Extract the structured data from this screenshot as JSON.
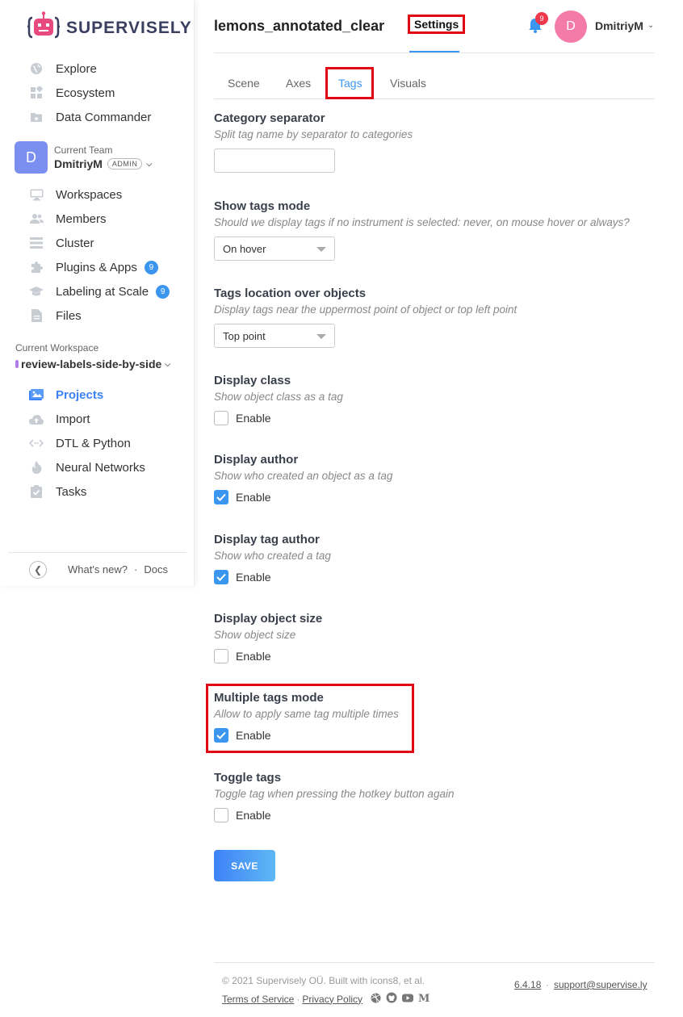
{
  "brand": {
    "name": "SUPERVISELY"
  },
  "sidebar": {
    "top_items": [
      {
        "label": "Explore",
        "icon": "globe-icon"
      },
      {
        "label": "Ecosystem",
        "icon": "grid-icon"
      },
      {
        "label": "Data Commander",
        "icon": "folder-star-icon"
      }
    ],
    "team": {
      "label": "Current Team",
      "name": "DmitriyM",
      "role": "ADMIN",
      "avatar_letter": "D"
    },
    "team_items": [
      {
        "label": "Workspaces",
        "icon": "monitor-icon"
      },
      {
        "label": "Members",
        "icon": "users-icon"
      },
      {
        "label": "Cluster",
        "icon": "list-icon"
      },
      {
        "label": "Plugins & Apps",
        "icon": "puzzle-icon",
        "badge": "9"
      },
      {
        "label": "Labeling at Scale",
        "icon": "graduation-cap-icon",
        "badge": "9"
      },
      {
        "label": "Files",
        "icon": "file-icon"
      }
    ],
    "workspace": {
      "label": "Current Workspace",
      "name": "review-labels-side-by-side"
    },
    "workspace_items": [
      {
        "label": "Projects",
        "icon": "images-icon",
        "active": true
      },
      {
        "label": "Import",
        "icon": "cloud-upload-icon"
      },
      {
        "label": "DTL & Python",
        "icon": "code-icon"
      },
      {
        "label": "Neural Networks",
        "icon": "fire-icon"
      },
      {
        "label": "Tasks",
        "icon": "clipboard-check-icon"
      }
    ],
    "footer": {
      "whats_new": "What's new?",
      "separator": "·",
      "docs": "Docs"
    }
  },
  "header": {
    "title": "lemons_annotated_clear",
    "tab": "Settings",
    "notifications": "9",
    "user": {
      "avatar_letter": "D",
      "name": "DmitriyM"
    }
  },
  "subtabs": [
    "Scene",
    "Axes",
    "Tags",
    "Visuals"
  ],
  "settings": {
    "category_separator": {
      "title": "Category separator",
      "desc": "Split tag name by separator to categories",
      "value": ""
    },
    "show_tags_mode": {
      "title": "Show tags mode",
      "desc": "Should we display tags if no instrument is selected: never, on mouse hover or always?",
      "value": "On hover"
    },
    "tags_location": {
      "title": "Tags location over objects",
      "desc": "Display tags near the uppermost point of object or top left point",
      "value": "Top point"
    },
    "display_class": {
      "title": "Display class",
      "desc": "Show object class as a tag",
      "label": "Enable",
      "checked": false
    },
    "display_author": {
      "title": "Display author",
      "desc": "Show who created an object as a tag",
      "label": "Enable",
      "checked": true
    },
    "display_tag_author": {
      "title": "Display tag author",
      "desc": "Show who created a tag",
      "label": "Enable",
      "checked": true
    },
    "display_object_size": {
      "title": "Display object size",
      "desc": "Show object size",
      "label": "Enable",
      "checked": false
    },
    "multiple_tags_mode": {
      "title": "Multiple tags mode",
      "desc": "Allow to apply same tag multiple times",
      "label": "Enable",
      "checked": true
    },
    "toggle_tags": {
      "title": "Toggle tags",
      "desc": "Toggle tag when pressing the hotkey button again",
      "label": "Enable",
      "checked": false
    }
  },
  "save_label": "SAVE",
  "footer": {
    "copyright": "© 2021 Supervisely OÜ. Built with icons8, et al.",
    "terms": "Terms of Service",
    "separator": "·",
    "privacy": "Privacy Policy",
    "version": "6.4.18",
    "support": "support@supervise.ly"
  },
  "colors": {
    "accent": "#3b96f0",
    "highlight": "#e30613",
    "brand_dark": "#3a3f60",
    "brand_pink": "#e84a7f"
  }
}
